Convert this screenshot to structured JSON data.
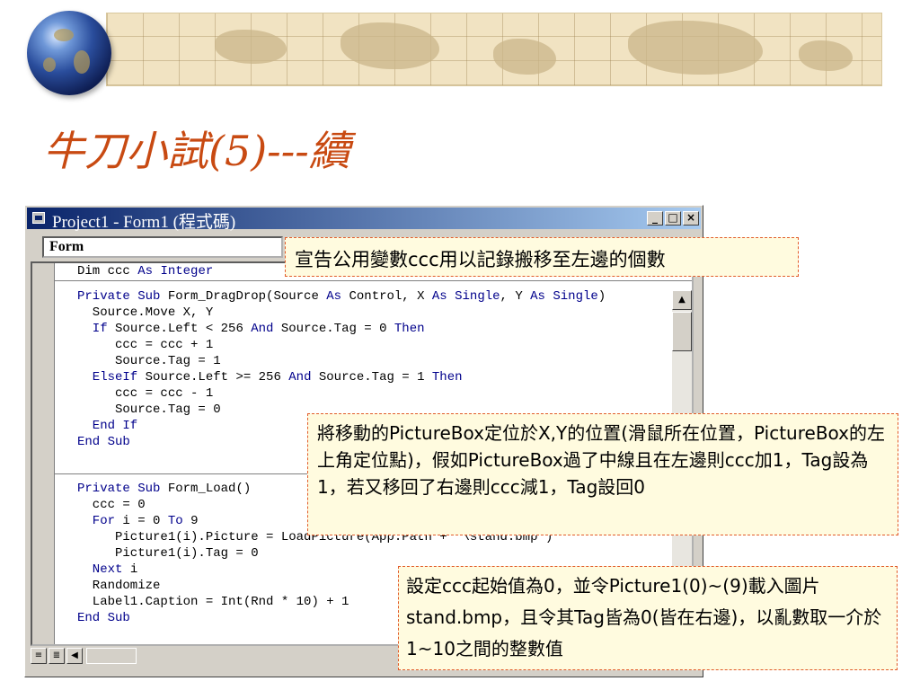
{
  "slide": {
    "title": "牛刀小試(5)---續"
  },
  "window": {
    "title": "Project1 - Form1 (程式碼)",
    "minimize": "_",
    "maximize": "□",
    "close": "×",
    "object_combo": "Form"
  },
  "code_lines": [
    [
      [
        "Dim ccc ",
        "plain"
      ],
      [
        "As ",
        "kw"
      ],
      [
        "Integer",
        "kw"
      ]
    ],
    [
      [
        "Private Sub ",
        "kw"
      ],
      [
        "Form_DragDrop(Source ",
        "plain"
      ],
      [
        "As ",
        "kw"
      ],
      [
        "Control, X ",
        "plain"
      ],
      [
        "As ",
        "kw"
      ],
      [
        "Single",
        "kw"
      ],
      [
        ", Y ",
        "plain"
      ],
      [
        "As ",
        "kw"
      ],
      [
        "Single",
        "kw"
      ],
      [
        ")",
        "plain"
      ]
    ],
    [
      [
        "  Source.Move X, Y",
        "plain"
      ]
    ],
    [
      [
        "  If ",
        "kw"
      ],
      [
        "Source.Left < 256 ",
        "plain"
      ],
      [
        "And ",
        "kw"
      ],
      [
        "Source.Tag = 0 ",
        "plain"
      ],
      [
        "Then",
        "kw"
      ]
    ],
    [
      [
        "     ccc = ccc + 1",
        "plain"
      ]
    ],
    [
      [
        "     Source.Tag = 1",
        "plain"
      ]
    ],
    [
      [
        "  ElseIf ",
        "kw"
      ],
      [
        "Source.Left >= 256 ",
        "plain"
      ],
      [
        "And ",
        "kw"
      ],
      [
        "Source.Tag = 1 ",
        "plain"
      ],
      [
        "Then",
        "kw"
      ]
    ],
    [
      [
        "     ccc = ccc - 1",
        "plain"
      ]
    ],
    [
      [
        "     Source.Tag = 0",
        "plain"
      ]
    ],
    [
      [
        "  End If",
        "kw"
      ]
    ],
    [
      [
        "End Sub",
        "kw"
      ]
    ],
    [
      [
        "Private Sub ",
        "kw"
      ],
      [
        "Form_Load()",
        "plain"
      ]
    ],
    [
      [
        "  ccc = 0",
        "plain"
      ]
    ],
    [
      [
        "  For ",
        "kw"
      ],
      [
        "i = 0 ",
        "plain"
      ],
      [
        "To ",
        "kw"
      ],
      [
        "9",
        "plain"
      ]
    ],
    [
      [
        "     Picture1(i).Picture = LoadPicture(App.Path + \"\\stand.bmp\")",
        "plain"
      ]
    ],
    [
      [
        "     Picture1(i).Tag = 0",
        "plain"
      ]
    ],
    [
      [
        "  Next ",
        "kw"
      ],
      [
        "i",
        "plain"
      ]
    ],
    [
      [
        "  Randomize",
        "plain"
      ]
    ],
    [
      [
        "  Label1.Caption = Int(Rnd * 10) + 1",
        "plain"
      ]
    ],
    [
      [
        "End Sub",
        "kw"
      ]
    ]
  ],
  "callouts": {
    "c1": "宣告公用變數ccc用以記錄搬移至左邊的個數",
    "c2": "將移動的PictureBox定位於X,Y的位置(滑鼠所在位置，PictureBox的左上角定位點)，假如PictureBox過了中線且在左邊則ccc加1，Tag設為1，若又移回了右邊則ccc減1，Tag設回0",
    "c3": "設定ccc起始值為0，並令Picture1(0)~(9)載入圖片stand.bmp，且令其Tag皆為0(皆在右邊)，以亂數取一介於1~10之間的整數值"
  },
  "icons": {
    "banner": "world-map-banner",
    "globe": "globe-icon",
    "window": "vb-code-window-icon"
  },
  "colors": {
    "title": "#c84a12",
    "titlebar_start": "#0a246a",
    "titlebar_end": "#a6caf0",
    "keyword": "#00008b",
    "callout_bg": "#fffbdf",
    "callout_border": "#e25c2b"
  }
}
